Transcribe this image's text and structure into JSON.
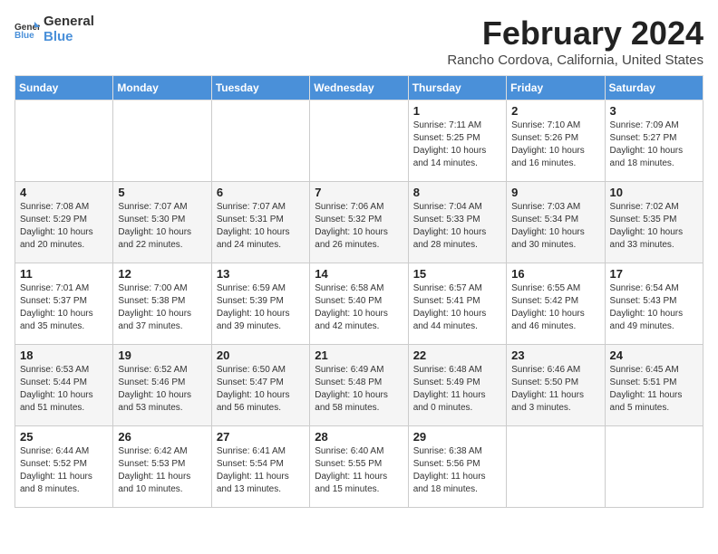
{
  "logo": {
    "general": "General",
    "blue": "Blue"
  },
  "title": "February 2024",
  "location": "Rancho Cordova, California, United States",
  "days_of_week": [
    "Sunday",
    "Monday",
    "Tuesday",
    "Wednesday",
    "Thursday",
    "Friday",
    "Saturday"
  ],
  "weeks": [
    [
      {
        "day": "",
        "info": ""
      },
      {
        "day": "",
        "info": ""
      },
      {
        "day": "",
        "info": ""
      },
      {
        "day": "",
        "info": ""
      },
      {
        "day": "1",
        "info": "Sunrise: 7:11 AM\nSunset: 5:25 PM\nDaylight: 10 hours\nand 14 minutes."
      },
      {
        "day": "2",
        "info": "Sunrise: 7:10 AM\nSunset: 5:26 PM\nDaylight: 10 hours\nand 16 minutes."
      },
      {
        "day": "3",
        "info": "Sunrise: 7:09 AM\nSunset: 5:27 PM\nDaylight: 10 hours\nand 18 minutes."
      }
    ],
    [
      {
        "day": "4",
        "info": "Sunrise: 7:08 AM\nSunset: 5:29 PM\nDaylight: 10 hours\nand 20 minutes."
      },
      {
        "day": "5",
        "info": "Sunrise: 7:07 AM\nSunset: 5:30 PM\nDaylight: 10 hours\nand 22 minutes."
      },
      {
        "day": "6",
        "info": "Sunrise: 7:07 AM\nSunset: 5:31 PM\nDaylight: 10 hours\nand 24 minutes."
      },
      {
        "day": "7",
        "info": "Sunrise: 7:06 AM\nSunset: 5:32 PM\nDaylight: 10 hours\nand 26 minutes."
      },
      {
        "day": "8",
        "info": "Sunrise: 7:04 AM\nSunset: 5:33 PM\nDaylight: 10 hours\nand 28 minutes."
      },
      {
        "day": "9",
        "info": "Sunrise: 7:03 AM\nSunset: 5:34 PM\nDaylight: 10 hours\nand 30 minutes."
      },
      {
        "day": "10",
        "info": "Sunrise: 7:02 AM\nSunset: 5:35 PM\nDaylight: 10 hours\nand 33 minutes."
      }
    ],
    [
      {
        "day": "11",
        "info": "Sunrise: 7:01 AM\nSunset: 5:37 PM\nDaylight: 10 hours\nand 35 minutes."
      },
      {
        "day": "12",
        "info": "Sunrise: 7:00 AM\nSunset: 5:38 PM\nDaylight: 10 hours\nand 37 minutes."
      },
      {
        "day": "13",
        "info": "Sunrise: 6:59 AM\nSunset: 5:39 PM\nDaylight: 10 hours\nand 39 minutes."
      },
      {
        "day": "14",
        "info": "Sunrise: 6:58 AM\nSunset: 5:40 PM\nDaylight: 10 hours\nand 42 minutes."
      },
      {
        "day": "15",
        "info": "Sunrise: 6:57 AM\nSunset: 5:41 PM\nDaylight: 10 hours\nand 44 minutes."
      },
      {
        "day": "16",
        "info": "Sunrise: 6:55 AM\nSunset: 5:42 PM\nDaylight: 10 hours\nand 46 minutes."
      },
      {
        "day": "17",
        "info": "Sunrise: 6:54 AM\nSunset: 5:43 PM\nDaylight: 10 hours\nand 49 minutes."
      }
    ],
    [
      {
        "day": "18",
        "info": "Sunrise: 6:53 AM\nSunset: 5:44 PM\nDaylight: 10 hours\nand 51 minutes."
      },
      {
        "day": "19",
        "info": "Sunrise: 6:52 AM\nSunset: 5:46 PM\nDaylight: 10 hours\nand 53 minutes."
      },
      {
        "day": "20",
        "info": "Sunrise: 6:50 AM\nSunset: 5:47 PM\nDaylight: 10 hours\nand 56 minutes."
      },
      {
        "day": "21",
        "info": "Sunrise: 6:49 AM\nSunset: 5:48 PM\nDaylight: 10 hours\nand 58 minutes."
      },
      {
        "day": "22",
        "info": "Sunrise: 6:48 AM\nSunset: 5:49 PM\nDaylight: 11 hours\nand 0 minutes."
      },
      {
        "day": "23",
        "info": "Sunrise: 6:46 AM\nSunset: 5:50 PM\nDaylight: 11 hours\nand 3 minutes."
      },
      {
        "day": "24",
        "info": "Sunrise: 6:45 AM\nSunset: 5:51 PM\nDaylight: 11 hours\nand 5 minutes."
      }
    ],
    [
      {
        "day": "25",
        "info": "Sunrise: 6:44 AM\nSunset: 5:52 PM\nDaylight: 11 hours\nand 8 minutes."
      },
      {
        "day": "26",
        "info": "Sunrise: 6:42 AM\nSunset: 5:53 PM\nDaylight: 11 hours\nand 10 minutes."
      },
      {
        "day": "27",
        "info": "Sunrise: 6:41 AM\nSunset: 5:54 PM\nDaylight: 11 hours\nand 13 minutes."
      },
      {
        "day": "28",
        "info": "Sunrise: 6:40 AM\nSunset: 5:55 PM\nDaylight: 11 hours\nand 15 minutes."
      },
      {
        "day": "29",
        "info": "Sunrise: 6:38 AM\nSunset: 5:56 PM\nDaylight: 11 hours\nand 18 minutes."
      },
      {
        "day": "",
        "info": ""
      },
      {
        "day": "",
        "info": ""
      }
    ]
  ]
}
